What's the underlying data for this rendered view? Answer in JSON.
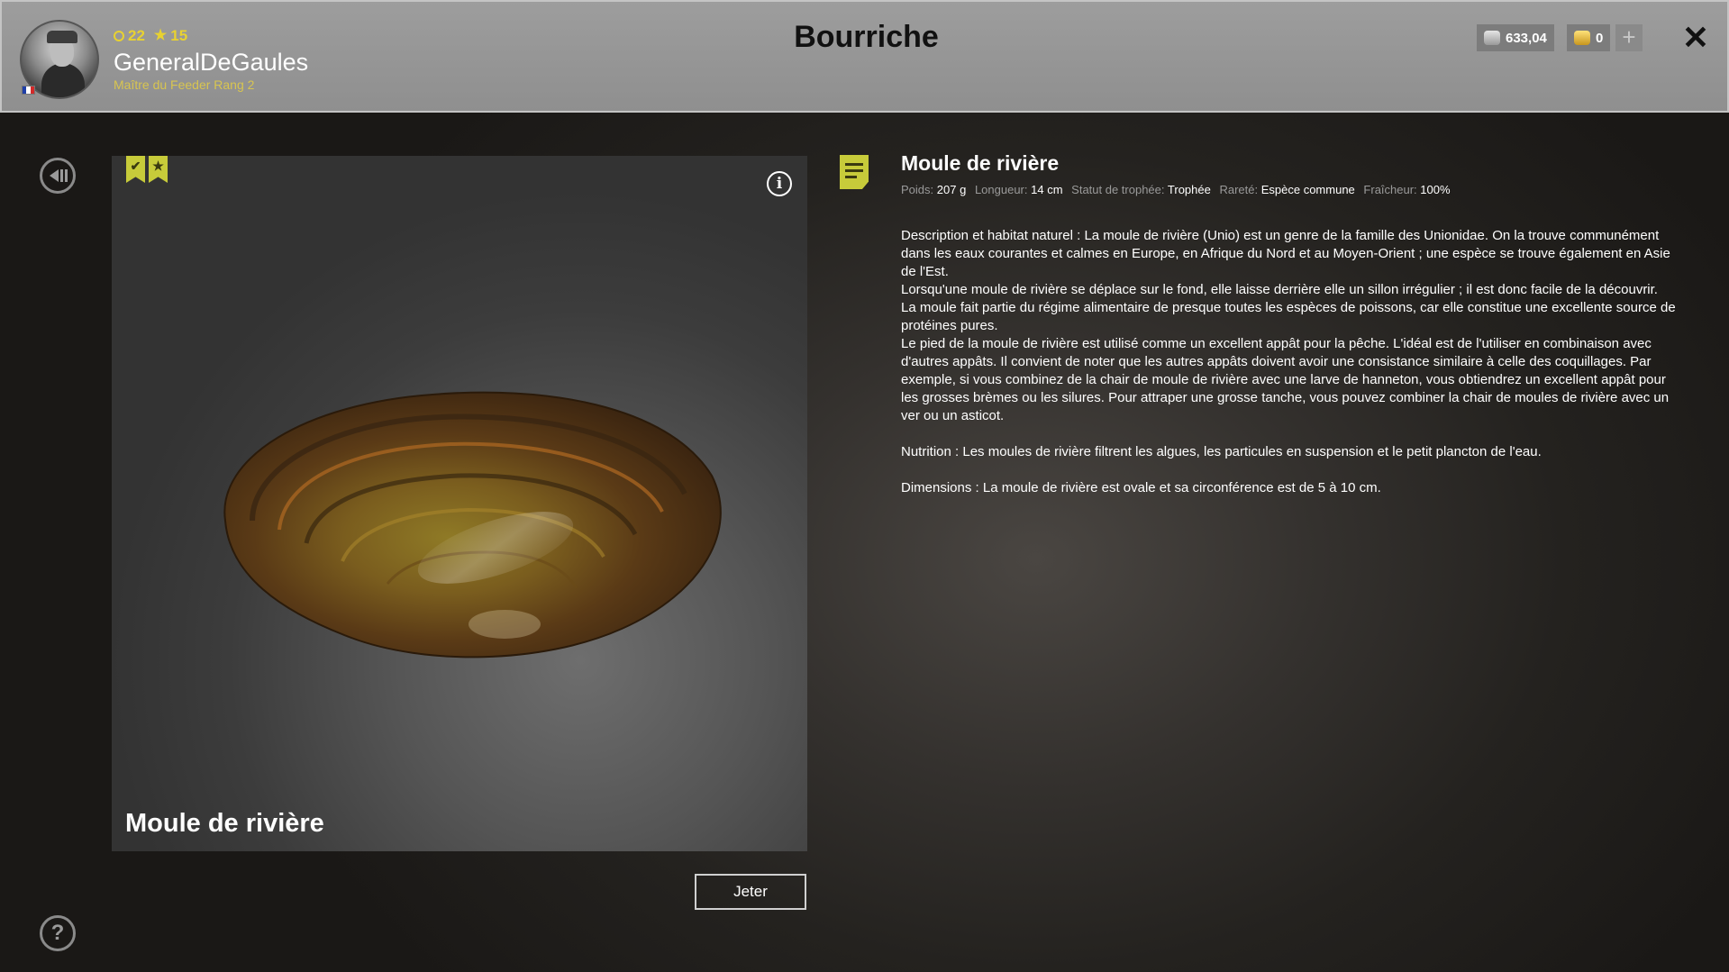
{
  "header": {
    "title": "Bourriche",
    "player": {
      "name": "GeneralDeGaules",
      "rank": "Maître du Feeder Rang 2",
      "level": "22",
      "stars": "15"
    },
    "currency": {
      "silver": "633,04",
      "gold": "0"
    },
    "close_label": "✕",
    "add_label": "+"
  },
  "fish": {
    "name": "Moule de rivière",
    "title": "Moule de rivière",
    "stats": {
      "weight_label": "Poids:",
      "weight_value": "207 g",
      "length_label": "Longueur:",
      "length_value": "14 cm",
      "trophy_label": "Statut de trophée:",
      "trophy_value": "Trophée",
      "rarity_label": "Rareté:",
      "rarity_value": "Espèce commune",
      "freshness_label": "Fraîcheur:",
      "freshness_value": "100%"
    },
    "description": [
      "Description et habitat naturel : La moule de rivière (Unio) est un genre de la famille des Unionidae. On la trouve communément dans les eaux courantes et calmes en Europe, en Afrique du Nord et au Moyen-Orient ; une espèce se trouve également en Asie de l'Est.",
      "Lorsqu'une moule de rivière se déplace sur le fond, elle laisse derrière elle un sillon irrégulier ; il est donc facile de la découvrir.",
      "La moule fait partie du régime alimentaire de presque toutes les espèces de poissons, car elle constitue une excellente source de protéines pures.",
      "Le pied de la moule de rivière est utilisé comme un excellent appât pour la pêche. L'idéal est de l'utiliser en combinaison avec d'autres appâts. Il convient de noter que les autres appâts doivent avoir une consistance similaire à celle des coquillages. Par exemple, si vous combinez de la chair de moule de rivière avec une larve de hanneton, vous obtiendrez un excellent appât pour les grosses brèmes ou les silures. Pour attraper une grosse tanche, vous pouvez combiner la chair de moules de rivière avec un ver ou un asticot."
    ],
    "nutrition": "Nutrition : Les moules de rivière filtrent les algues, les particules en suspension et le petit plancton de l'eau.",
    "dimensions": "Dimensions : La moule de rivière est ovale et sa circonférence est de 5 à 10 cm."
  },
  "actions": {
    "discard_label": "Jeter",
    "info_label": "i",
    "help_label": "?"
  },
  "colors": {
    "accent": "#c7cb3a",
    "stat_yellow": "#e8d230",
    "header_bg": "#959595"
  }
}
